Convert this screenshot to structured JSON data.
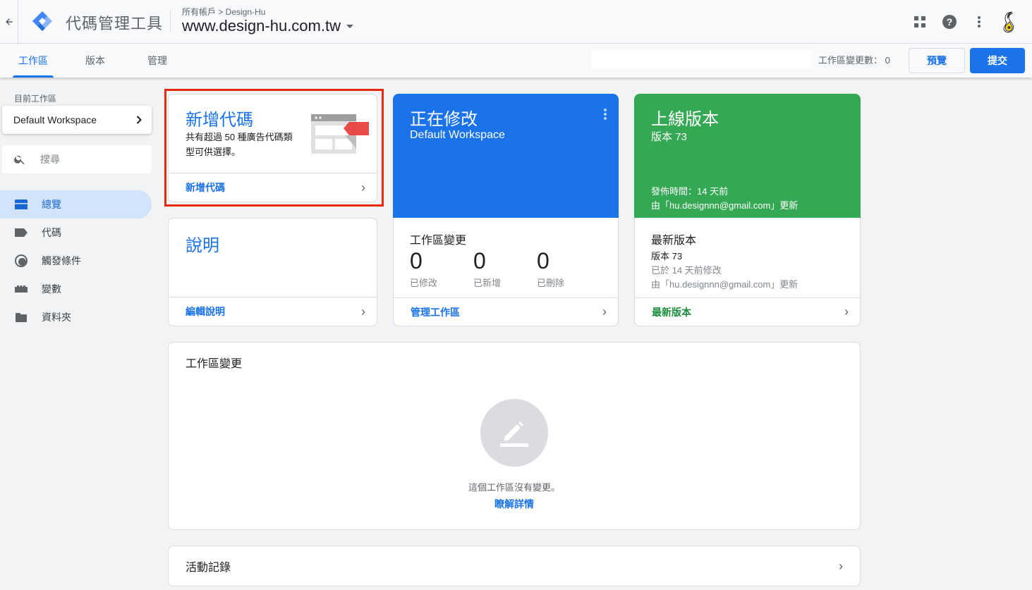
{
  "header": {
    "app_title": "代碼管理工具",
    "breadcrumb": "所有帳戶 > Design-Hu",
    "container_name": "www.design-hu.com.tw",
    "icons": [
      "back-arrow-icon",
      "gtm-logo-icon",
      "apps-grid-icon",
      "help-icon",
      "more-vert-icon",
      "account-avatar-icon"
    ]
  },
  "subnav": {
    "tabs": [
      {
        "label": "工作區",
        "active": true
      },
      {
        "label": "版本",
        "active": false
      },
      {
        "label": "管理",
        "active": false
      }
    ],
    "change_count_label": "工作區變更數：",
    "change_count_value": "0",
    "preview_label": "預覽",
    "submit_label": "提交"
  },
  "sidebar": {
    "workspace_label": "目前工作區",
    "workspace_name": "Default Workspace",
    "search_placeholder": "搜尋",
    "items": [
      {
        "label": "總覽",
        "icon": "overview-icon",
        "active": true
      },
      {
        "label": "代碼",
        "icon": "tag-icon",
        "active": false
      },
      {
        "label": "觸發條件",
        "icon": "trigger-icon",
        "active": false
      },
      {
        "label": "變數",
        "icon": "variable-icon",
        "active": false
      },
      {
        "label": "資料夾",
        "icon": "folder-icon",
        "active": false
      }
    ]
  },
  "cards": {
    "new_tag": {
      "title": "新增代碼",
      "description": "共有超過 50 種廣告代碼類型可供選擇。",
      "link": "新增代碼"
    },
    "description": {
      "title": "說明",
      "link": "編輯說明"
    },
    "editing": {
      "title": "正在修改",
      "subtitle": "Default Workspace",
      "section_title": "工作區變更",
      "stats": [
        {
          "value": "0",
          "label": "已修改"
        },
        {
          "value": "0",
          "label": "已新增"
        },
        {
          "value": "0",
          "label": "已刪除"
        }
      ],
      "link": "管理工作區",
      "color": "#1a73e8"
    },
    "live": {
      "title": "上線版本",
      "subtitle": "版本 73",
      "published": "發佈時間：14 天前",
      "updated_by": "由「hu.designnn@gmail.com」更新",
      "section_title": "最新版本",
      "latest_version": "版本 73",
      "latest_modified": "已於 14 天前修改",
      "latest_updated_by": "由「hu.designnn@gmail.com」更新",
      "link": "最新版本",
      "color": "#34a853"
    }
  },
  "workspace_changes": {
    "title": "工作區變更",
    "empty_text": "這個工作區沒有變更。",
    "learn_more": "瞭解詳情"
  },
  "activity": {
    "title": "活動記錄"
  }
}
